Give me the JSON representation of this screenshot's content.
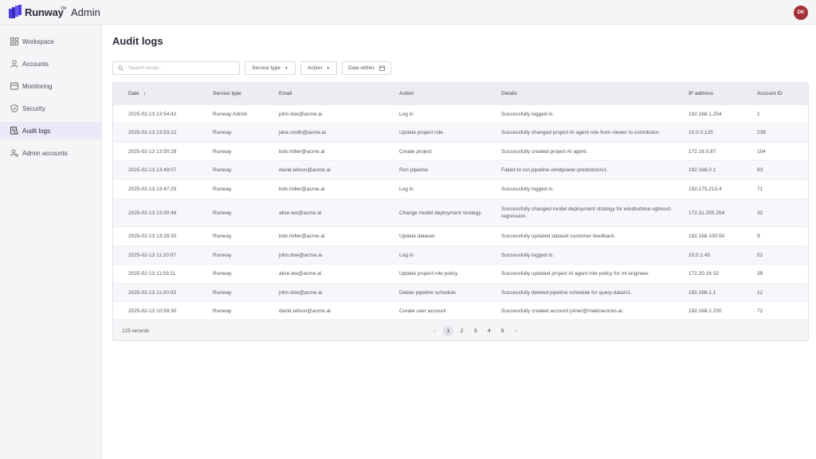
{
  "header": {
    "brand": "Runway",
    "brand_mark": "TM",
    "brand_suffix": "Admin",
    "avatar_initials": "DK",
    "accent": "#a6303a"
  },
  "sidebar": {
    "items": [
      {
        "label": "Workspace",
        "icon": "grid-icon"
      },
      {
        "label": "Accounts",
        "icon": "user-icon"
      },
      {
        "label": "Monitoring",
        "icon": "monitor-icon"
      },
      {
        "label": "Security",
        "icon": "shield-icon"
      },
      {
        "label": "Audit logs",
        "icon": "audit-icon",
        "active": true
      },
      {
        "label": "Admin accounts",
        "icon": "admin-icon"
      }
    ]
  },
  "main": {
    "title": "Audit logs",
    "filters": {
      "search_placeholder": "Search email..",
      "service_type": "Service type",
      "action": "Action",
      "date_within": "Date within:"
    },
    "table": {
      "columns": [
        "Date",
        "Service type",
        "Email",
        "Action",
        "Details",
        "IP address",
        "Account ID"
      ],
      "rows": [
        [
          "2025-02-13 13:54:42",
          "Runway Admin",
          "john.doe@acme.ai",
          "Log in",
          "Successfully logged in.",
          "192.168.1.254",
          "1"
        ],
        [
          "2025-02-13 13:53:12",
          "Runway",
          "jane.smith@acme.ai",
          "Update project role",
          "Successfully changed project AI agent role from viewer to contributor.",
          "10.0.0.125",
          "239"
        ],
        [
          "2025-02-13 13:50:29",
          "Runway",
          "bob.miller@acme.ai",
          "Create project",
          "Successfully created project AI agent.",
          "172.16.0.87",
          "104"
        ],
        [
          "2025-02-13 13:48:07",
          "Runway",
          "david.wilson@acme.ai",
          "Run pipeline",
          "Failed to run pipeline windpower-prediction/v1.",
          "192.168.0.1",
          "93"
        ],
        [
          "2025-02-13 13:47:25",
          "Runway",
          "bob.miller@acme.ai",
          "Log in",
          "Successfully logged in.",
          "192.175.213.4",
          "71"
        ],
        [
          "2025-02-13 13:30:46",
          "Runway",
          "alice.lee@acme.ai",
          "Change model deployment strategy",
          "Successfully changed model deployment strategy for windturbine-xgboost-regression.",
          "172.31.255.254",
          "32"
        ],
        [
          "2025-02-13 13:29:30",
          "Runway",
          "bob.miller@acme.ai",
          "Update dataset",
          "Successfully updated dataset customer-feedback.",
          "192.168.100.50",
          "9"
        ],
        [
          "2025-02-13 11:20:07",
          "Runway",
          "john.doe@acme.ai",
          "Log in",
          "Successfully logged in.",
          "10.0.1.45",
          "52"
        ],
        [
          "2025-02-13 11:03:11",
          "Runway",
          "alice.lee@acme.ai",
          "Update project role policy",
          "Successfully updated project AI agent role policy for ml engineer.",
          "172.20.16.32",
          "39"
        ],
        [
          "2025-02-13 11:00:03",
          "Runway",
          "john.doe@acme.ai",
          "Delete pipeline schedule",
          "Successfully deleted pipeline schedule for query-data/v1.",
          "192.168.1.1",
          "12"
        ],
        [
          "2025-02-13 10:59:30",
          "Runway",
          "david.wilson@acme.ai",
          "Create user account",
          "Successfully created account joiner@makinarocks.ai.",
          "192.168.2.200",
          "72"
        ]
      ]
    },
    "footer": {
      "records": "125 records",
      "pages": [
        "1",
        "2",
        "3",
        "4",
        "5"
      ],
      "current_page": "1",
      "prev": "‹",
      "next": "›"
    }
  }
}
